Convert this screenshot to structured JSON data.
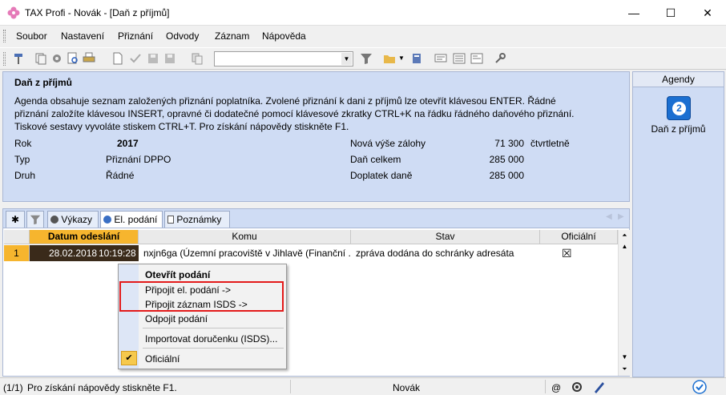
{
  "window": {
    "title": "TAX Profi - Novák - [Daň z příjmů]",
    "minimize": "—",
    "maximize": "☐",
    "close": "✕"
  },
  "menu": [
    "Soubor",
    "Nastavení",
    "Přiznání",
    "Odvody",
    "Záznam",
    "Nápověda"
  ],
  "info": {
    "heading": "Daň z příjmů",
    "desc": "Agenda obsahuje seznam založených přiznání poplatníka. Zvolené přiznání k dani z příjmů lze otevřít klávesou ENTER. Řádné přiznání založíte klávesou INSERT, opravné či dodatečné pomocí klávesové zkratky CTRL+K na řádku řádného daňového přiznání. Tiskové sestavy vyvoláte stiskem CTRL+T. Pro získání nápovědy stiskněte F1.",
    "rok_label": "Rok",
    "rok_value": "2017",
    "typ_label": "Typ",
    "typ_value": "Přiznání DPPO",
    "druh_label": "Druh",
    "druh_value": "Řádné",
    "zaloha_label": "Nová výše zálohy",
    "zaloha_value": "71 300",
    "zaloha_period": "čtvrtletně",
    "celkem_label": "Daň celkem",
    "celkem_value": "285 000",
    "doplatek_label": "Doplatek daně",
    "doplatek_value": "285 000"
  },
  "tabs": {
    "vykazy": "Výkazy",
    "el_podani": "El. podání",
    "poznamky": "Poznámky"
  },
  "grid": {
    "columns": [
      "Datum odeslání",
      "Komu",
      "Stav",
      "Oficiální"
    ],
    "row": {
      "index": "1",
      "date": "28.02.2018",
      "time": "10:19:28",
      "komu": "nxjn6ga (Územní pracoviště v Jihlavě (Finanční ...",
      "stav": "zpráva dodána do schránky adresáta",
      "oficialni": "☒"
    }
  },
  "context_menu": {
    "open": "Otevřít podání",
    "attach_el": "Připojit el. podání ->",
    "attach_isds": "Připojit záznam ISDS ->",
    "detach": "Odpojit podání",
    "import": "Importovat doručenku (ISDS)...",
    "official": "Oficiální",
    "check": "✔"
  },
  "agendy": {
    "header": "Agendy",
    "item": "Daň z příjmů"
  },
  "status": {
    "count": "(1/1)",
    "hint": "Pro získání nápovědy stiskněte F1.",
    "user": "Novák",
    "at": "@"
  },
  "colors": {
    "accent_sort": "#f6b52e",
    "panel": "#cfdcf4",
    "highlight": "#e31a1a"
  }
}
